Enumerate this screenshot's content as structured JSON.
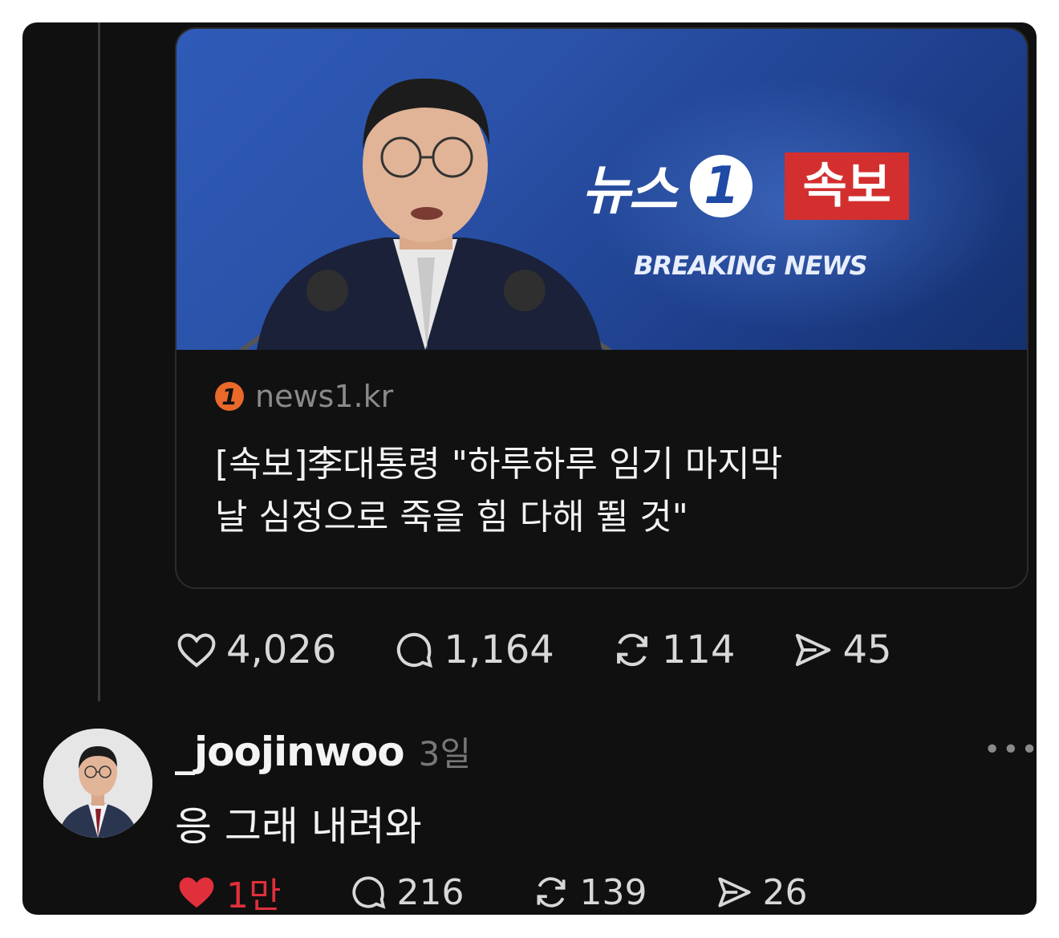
{
  "card": {
    "image": {
      "brand_name": "뉴스",
      "brand_logo_char": "1",
      "badge": "속보",
      "tagline": "BREAKING NEWS"
    },
    "source_logo_char": "1",
    "source": "news1.kr",
    "title_lines": [
      "[속보]李대통령 \"하루하루 임기 마지막",
      "날 심정으로 죽을 힘 다해 뛸 것\""
    ]
  },
  "post_actions": {
    "likes": "4,026",
    "replies": "1,164",
    "reposts": "114",
    "shares": "45"
  },
  "reply": {
    "username": "_joojinwoo",
    "time": "3일",
    "more": "•••",
    "text": "응 그래 내려와",
    "actions": {
      "likes": "1만",
      "replies": "216",
      "reposts": "139",
      "shares": "26"
    }
  },
  "colors": {
    "background": "#101010",
    "liked": "#e0303b",
    "badge_red": "#d32f2f",
    "image_blue": "#2a52a8"
  }
}
